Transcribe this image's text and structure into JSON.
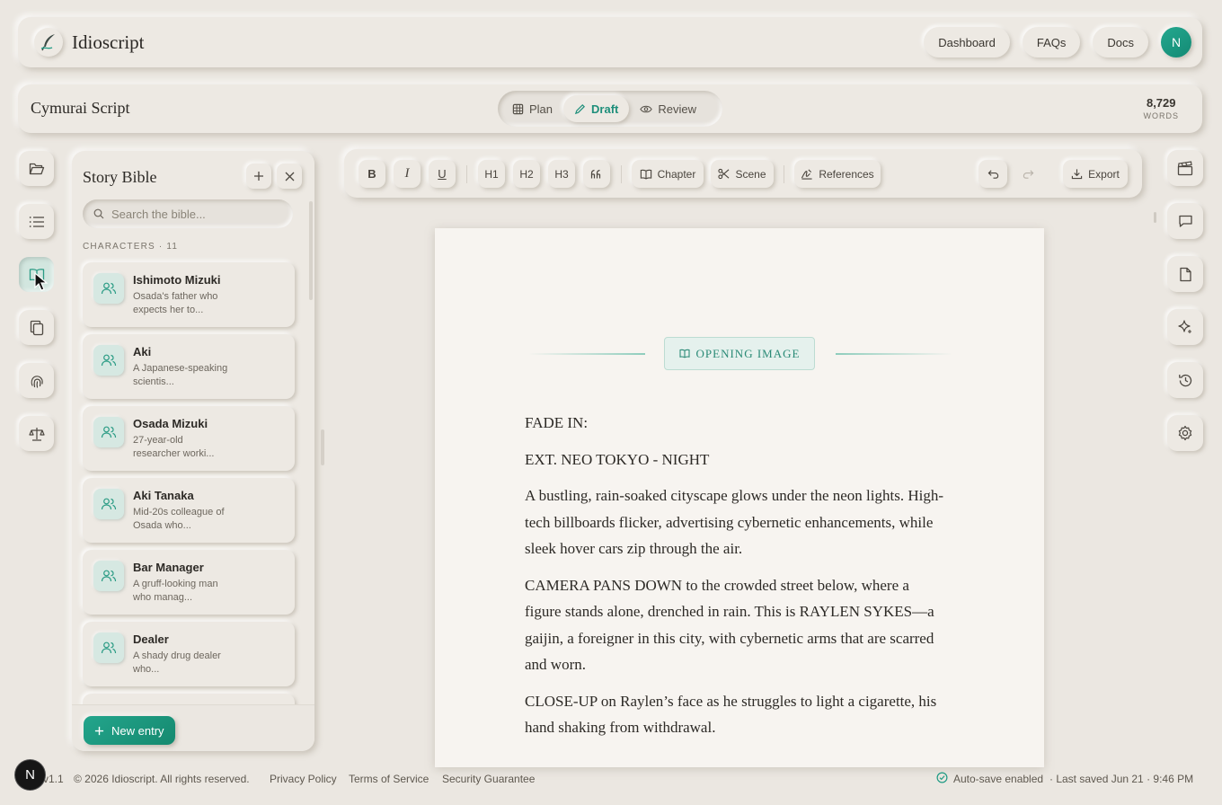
{
  "app": {
    "name": "Idioscript"
  },
  "nav": {
    "dashboard": "Dashboard",
    "faqs": "FAQs",
    "docs": "Docs",
    "avatar_initial": "N"
  },
  "project": {
    "title": "Cymurai Script",
    "modes": [
      "Plan",
      "Draft",
      "Review"
    ],
    "active_mode": "Draft",
    "word_count": "8,729",
    "word_label": "WORDS"
  },
  "bible": {
    "title": "Story Bible",
    "search_placeholder": "Search the bible...",
    "section_label": "CHARACTERS · 11",
    "characters": [
      {
        "name": "Ishimoto Mizuki",
        "desc": "Osada's father who expects her to..."
      },
      {
        "name": "Aki",
        "desc": "A Japanese-speaking scientis..."
      },
      {
        "name": "Osada Mizuki",
        "desc": "27-year-old researcher worki..."
      },
      {
        "name": "Aki Tanaka",
        "desc": "Mid-20s colleague of Osada who..."
      },
      {
        "name": "Bar Manager",
        "desc": "A gruff-looking man who manag..."
      },
      {
        "name": "Dealer",
        "desc": "A shady drug dealer who..."
      }
    ],
    "new_entry_label": "New entry"
  },
  "toolbar": {
    "bold": "B",
    "italic": "I",
    "underline": "U",
    "h1": "H1",
    "h2": "H2",
    "h3": "H3",
    "chapter": "Chapter",
    "scene": "Scene",
    "references": "References",
    "export": "Export"
  },
  "document": {
    "scene_tag": "OPENING IMAGE",
    "paragraphs": [
      "FADE IN:",
      "EXT. NEO TOKYO - NIGHT",
      "A bustling, rain-soaked cityscape glows under the neon lights. High-tech billboards flicker, advertising cybernetic enhancements, while sleek hover cars zip through the air.",
      "CAMERA PANS DOWN to the crowded street below, where a figure stands alone, drenched in rain. This is RAYLEN SYKES—a gaijin, a foreigner in this city, with cybernetic arms that are scarred and worn.",
      "CLOSE-UP on Raylen’s face as he struggles to light a cigarette, his hand shaking from withdrawal."
    ]
  },
  "footer": {
    "version": "v1.1",
    "copyright": "© 2026 Idioscript. All rights reserved.",
    "privacy": "Privacy Policy",
    "terms": "Terms of Service",
    "security": "Security Guarantee",
    "autosave": "Auto-save enabled",
    "last_saved": "· Last saved Jun 21 · 9:46 PM"
  },
  "badge": {
    "initial": "N"
  },
  "colors": {
    "accent": "#1f8f7b",
    "background": "#ebe7e1",
    "page": "#f7f4f0"
  }
}
